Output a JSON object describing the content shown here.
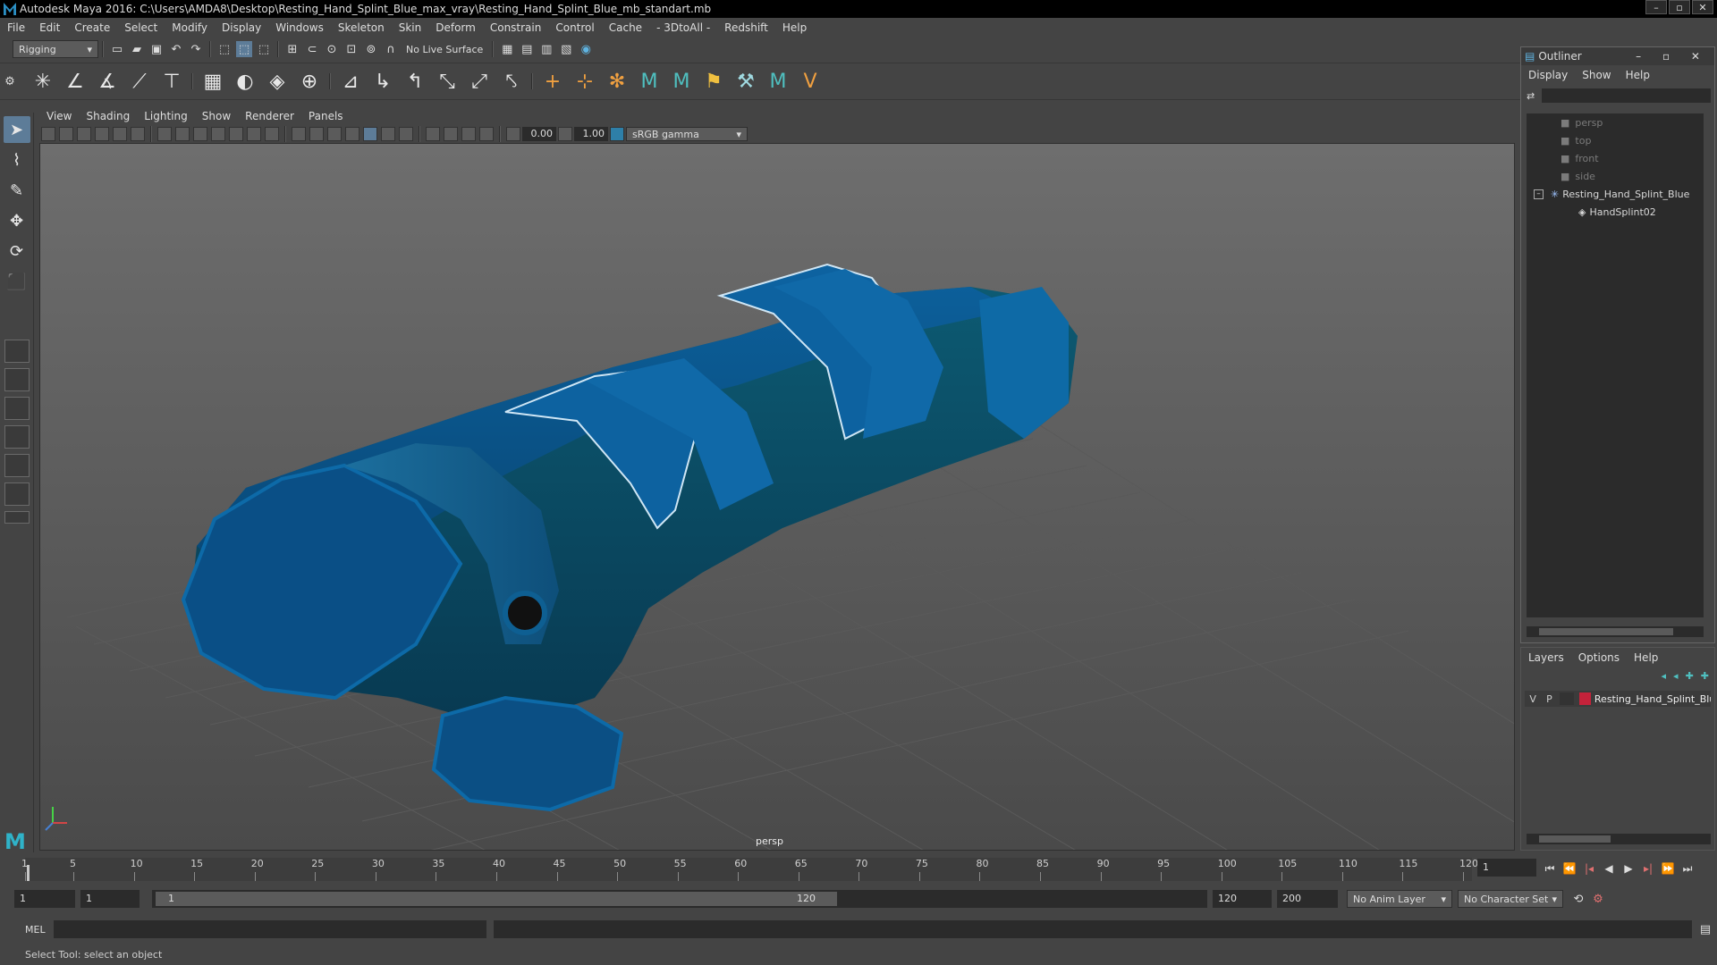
{
  "window": {
    "title": "Autodesk Maya 2016: C:\\Users\\AMDA8\\Desktop\\Resting_Hand_Splint_Blue_max_vray\\Resting_Hand_Splint_Blue_mb_standart.mb",
    "min": "–",
    "max": "▫",
    "close": "✕"
  },
  "menubar": [
    "File",
    "Edit",
    "Create",
    "Select",
    "Modify",
    "Display",
    "Windows",
    "Skeleton",
    "Skin",
    "Deform",
    "Constrain",
    "Control",
    "Cache",
    "- 3DtoAll -",
    "Redshift",
    "Help"
  ],
  "toolbar": {
    "mode": "Rigging",
    "live_surface": "No Live Surface"
  },
  "viewport": {
    "menu": [
      "View",
      "Shading",
      "Lighting",
      "Show",
      "Renderer",
      "Panels"
    ],
    "exposure": "0.00",
    "gamma": "1.00",
    "color_space": "sRGB gamma",
    "camera_label": "persp"
  },
  "outliner": {
    "title": "Outliner",
    "menu": [
      "Display",
      "Show",
      "Help"
    ],
    "items": [
      {
        "label": "persp",
        "type": "camera"
      },
      {
        "label": "top",
        "type": "camera"
      },
      {
        "label": "front",
        "type": "camera"
      },
      {
        "label": "side",
        "type": "camera"
      },
      {
        "label": "Resting_Hand_Splint_Blue",
        "type": "group",
        "expanded": true
      },
      {
        "label": "HandSplint02",
        "type": "mesh"
      }
    ]
  },
  "layers": {
    "menu": [
      "Layers",
      "Options",
      "Help"
    ],
    "row": {
      "v": "V",
      "p": "P",
      "name": "Resting_Hand_Splint_Blue",
      "color": "#c4223a"
    }
  },
  "timeline": {
    "ticks": [
      1,
      5,
      10,
      15,
      20,
      25,
      30,
      35,
      40,
      45,
      50,
      55,
      60,
      65,
      70,
      75,
      80,
      85,
      90,
      95,
      100,
      105,
      110,
      115,
      120
    ],
    "current_frame": "1"
  },
  "range": {
    "start": "1",
    "start_inner": "1",
    "slider_start": "1",
    "slider_end": "120",
    "end": "120",
    "end_outer": "200",
    "anim_layer": "No Anim Layer",
    "character_set": "No Character Set"
  },
  "command": {
    "lang": "MEL",
    "help": "Select Tool: select an object"
  }
}
